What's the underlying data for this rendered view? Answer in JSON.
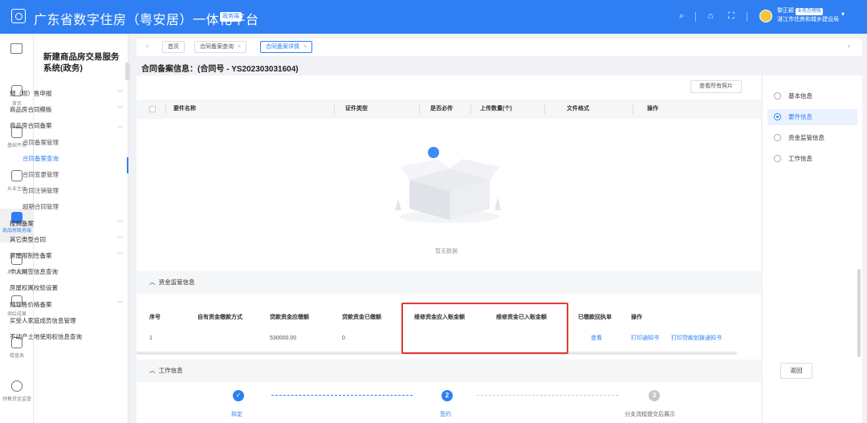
{
  "header": {
    "title": "广东省数字住房（粤安居）一体化平台",
    "badge": "政务端",
    "user_name": "黎正颖",
    "user_badge": "业务办理账",
    "user_org": "湛江市住房和城乡建设局"
  },
  "rail": [
    {
      "label": "首页",
      "icon": "home-icon"
    },
    {
      "label": "基础平台",
      "icon": "platform-icon"
    },
    {
      "label": "从业主体",
      "icon": "building-icon"
    },
    {
      "label": "商品房政务端",
      "icon": "house-icon"
    },
    {
      "label": "项目管理",
      "icon": "project-icon"
    },
    {
      "label": "测绘成果",
      "icon": "survey-icon"
    },
    {
      "label": "楼盘表",
      "icon": "layers-icon"
    },
    {
      "label": "预售资金监管",
      "icon": "fund-icon"
    }
  ],
  "menu": {
    "title": "新建商品房交易服务系统(政务)",
    "items": [
      {
        "label": "预（现）售申报",
        "level": 1,
        "caret": "﹀"
      },
      {
        "label": "商品房合同模板",
        "level": 1,
        "caret": "﹀"
      },
      {
        "label": "商品房合同备案",
        "level": 1,
        "caret": "︿"
      },
      {
        "label": "合同备案管理",
        "level": 2
      },
      {
        "label": "合同备案查询",
        "level": 2,
        "active": true
      },
      {
        "label": "合同变更管理",
        "level": 2
      },
      {
        "label": "合同注销管理",
        "level": 2
      },
      {
        "label": "超期合同管理",
        "level": 2
      },
      {
        "label": "按揭备案",
        "level": 1,
        "caret": "﹀"
      },
      {
        "label": "其它类型合同",
        "level": 1,
        "caret": "﹀"
      },
      {
        "label": "房屋限制性备案",
        "level": 1,
        "caret": "﹀"
      },
      {
        "label": "个人网签信息查询",
        "level": 1
      },
      {
        "label": "房屋权属校验设置",
        "level": 1
      },
      {
        "label": "预现售价格备案",
        "level": 1,
        "caret": "﹀"
      },
      {
        "label": "买受人家庭成员信息管理",
        "level": 1
      },
      {
        "label": "不动产土地使用权信息查询",
        "level": 1
      }
    ]
  },
  "tabs": [
    {
      "label": "首页"
    },
    {
      "label": "合同备案查询",
      "close": "×"
    },
    {
      "label": "合同备案详情",
      "close": "×",
      "active": true
    }
  ],
  "page": {
    "heading": "合同备案信息：(合同号 - YS202303031604)",
    "photos_button": "查看所有照片",
    "attachments": {
      "columns": [
        "要件名称",
        "证件类型",
        "是否必传",
        "上传数量(个)",
        "文件格式",
        "操作"
      ],
      "empty_text": "暂无数据"
    },
    "fund_section": {
      "title": "资金监管信息",
      "columns": [
        "序号",
        "自有资金缴款方式",
        "贷款资金应缴额",
        "贷款资金已缴额",
        "维修资金应入账金额",
        "维修资金已入账金额",
        "已缴款回执单",
        "操作"
      ],
      "rows": [
        {
          "index": "1",
          "own_fund_method": "",
          "loan_due": "530000.00",
          "loan_paid": "0",
          "maint_due": "",
          "maint_paid": "",
          "receipt_link": "查看",
          "action_notice": "打印通知书",
          "action_loan_notice": "打印贷款划拨通知书"
        }
      ]
    },
    "work_section": {
      "title": "工作信息",
      "steps": [
        {
          "number": "✓",
          "label": "拟定",
          "status": "done"
        },
        {
          "number": "2",
          "label": "签约",
          "status": "current"
        },
        {
          "number": "3",
          "label": "分支流程提交后展示",
          "status": "pending"
        }
      ]
    }
  },
  "anchors": [
    {
      "label": "基本信息"
    },
    {
      "label": "要件信息",
      "active": true
    },
    {
      "label": "资金监管信息"
    },
    {
      "label": "工作信息"
    }
  ],
  "back_button": "返回",
  "colors": {
    "primary": "#2f7ff3",
    "highlight_box": "#e53935"
  }
}
